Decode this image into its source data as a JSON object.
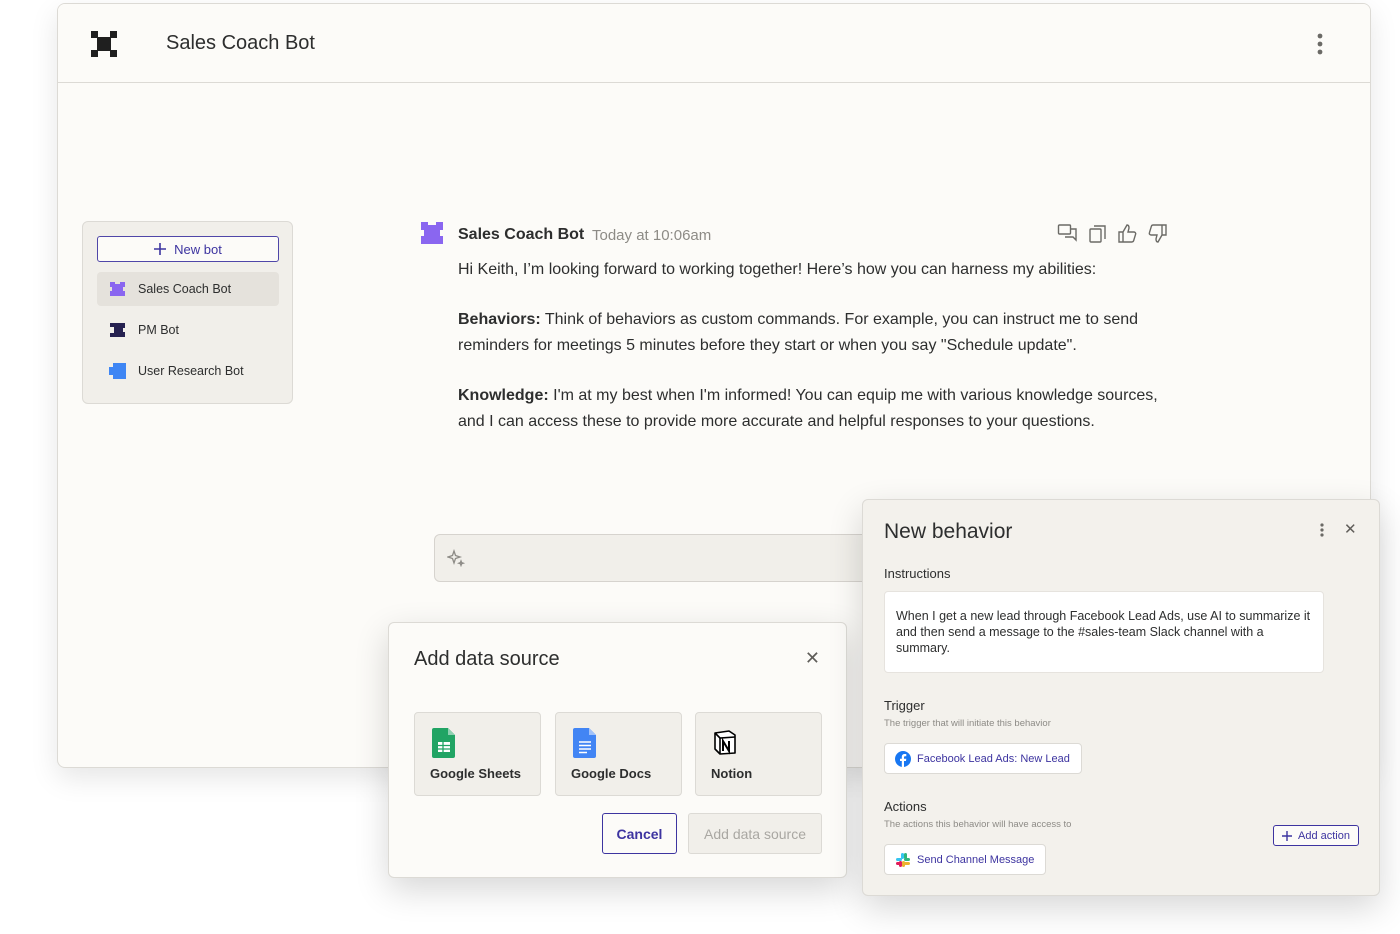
{
  "app": {
    "title": "Sales Coach Bot",
    "logo_icon": "zapier-logo-icon",
    "menu_icon": "vertical-dots-icon"
  },
  "sidebar": {
    "new_bot_label": "New bot",
    "items": [
      {
        "label": "Sales Coach Bot",
        "active": true,
        "color": "#8a66f0"
      },
      {
        "label": "PM Bot",
        "active": false,
        "color": "#262150"
      },
      {
        "label": "User Research Bot",
        "active": false,
        "color": "#3f86f4"
      }
    ]
  },
  "message": {
    "sender": "Sales Coach Bot",
    "time": "Today at 10:06am",
    "intro": "Hi Keith, I’m looking forward to working together! Here’s how you can harness my abilities:",
    "behaviors_heading": "Behaviors:",
    "behaviors_text": " Think of behaviors as custom commands.  For example, you can instruct me to send reminders for meetings 5 minutes before they start or when you say \"Schedule update\".",
    "knowledge_heading": "Knowledge:",
    "knowledge_text": " I'm at my best when I'm informed! You can equip me with various knowledge sources, and I can access these to provide more accurate and helpful responses to your questions.",
    "action_icons": [
      "chat-bubbles-icon",
      "copy-icon",
      "thumbs-up-icon",
      "thumbs-down-icon"
    ]
  },
  "chat_input": {
    "icon": "sparkle-icon"
  },
  "data_source_modal": {
    "title": "Add data source",
    "sources": [
      {
        "label": "Google Sheets",
        "icon": "google-sheets-icon",
        "color": "#21a464"
      },
      {
        "label": "Google Docs",
        "icon": "google-docs-icon",
        "color": "#4285f4"
      },
      {
        "label": "Notion",
        "icon": "notion-icon",
        "color": "#000000"
      }
    ],
    "cancel_label": "Cancel",
    "add_label": "Add data source"
  },
  "behavior_panel": {
    "title": "New behavior",
    "instructions_label": "Instructions",
    "instructions_text": "When I get a new lead through Facebook Lead Ads, use AI to summarize it and then send a message to the #sales-team Slack channel with a summary.",
    "trigger_label": "Trigger",
    "trigger_sub": "The trigger that will initiate this behavior",
    "trigger_chip": "Facebook Lead Ads: New Lead",
    "actions_label": "Actions",
    "actions_sub": "The actions this behavior will have access to",
    "add_action_label": "Add action",
    "action_chip": "Send Channel Message"
  },
  "colors": {
    "accent": "#3d34a0",
    "background": "#fcfbf8",
    "panel": "#f3f1ec"
  }
}
